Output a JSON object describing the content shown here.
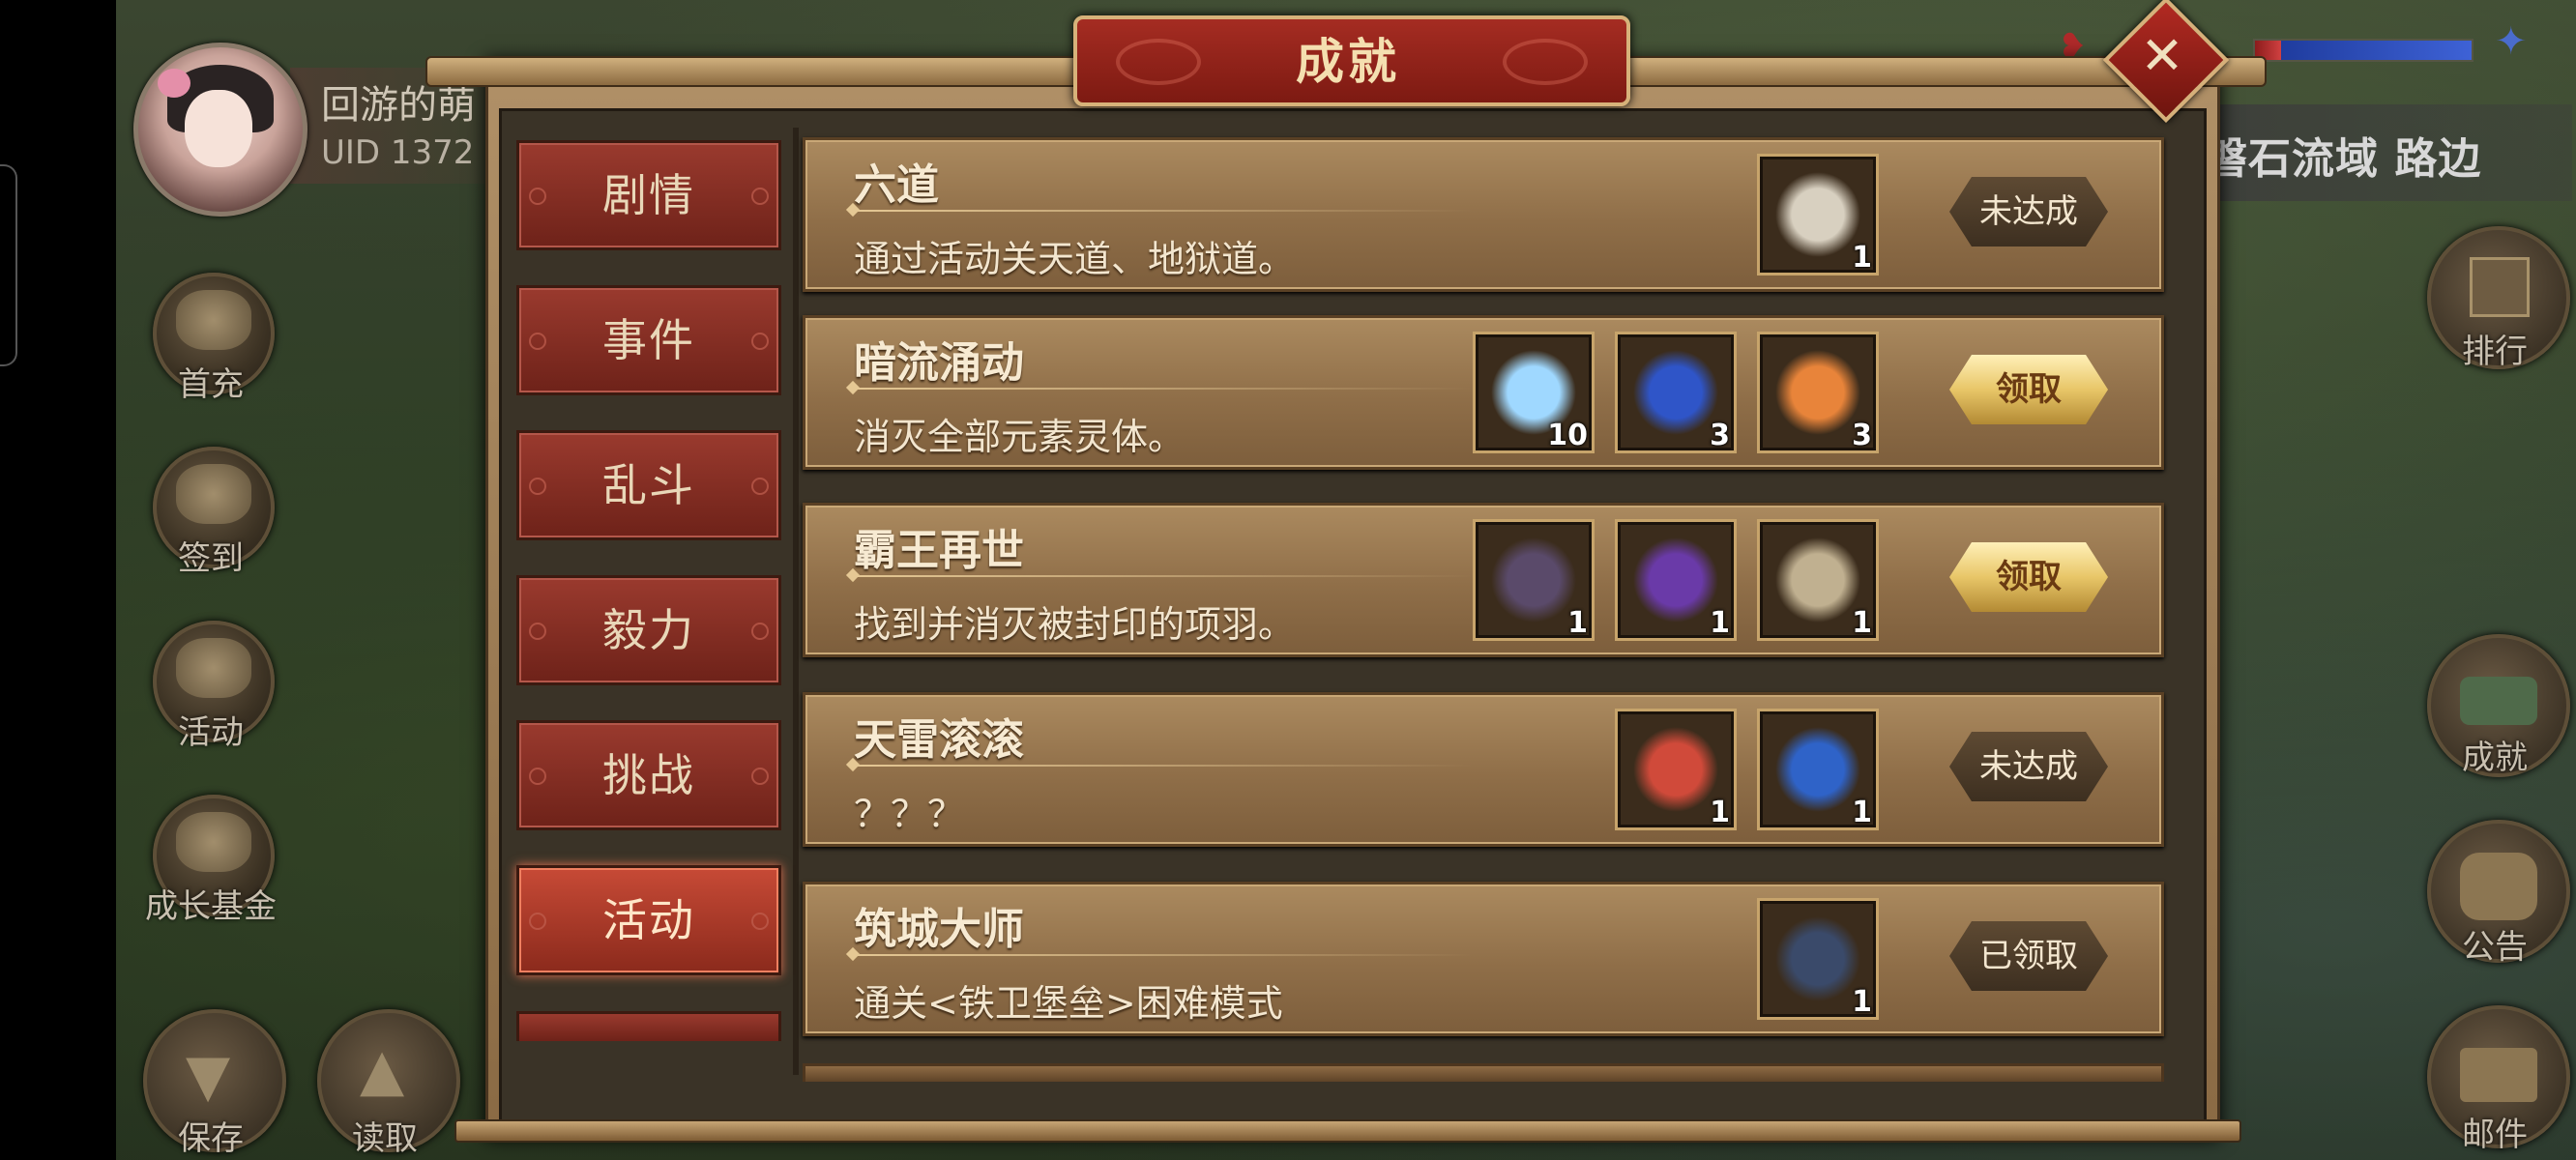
{
  "player": {
    "name": "回游的萌",
    "uid": "UID 1372"
  },
  "left_menu": [
    {
      "label": "首充",
      "icon": "gift-icon"
    },
    {
      "label": "签到",
      "icon": "scroll-brush-icon"
    },
    {
      "label": "活动",
      "icon": "treasure-icon"
    },
    {
      "label": "成长基金",
      "icon": "plant-icon"
    }
  ],
  "bottom_left": [
    {
      "label": "保存",
      "icon": "save-down-arrow-icon"
    },
    {
      "label": "读取",
      "icon": "load-up-arrow-icon"
    }
  ],
  "right_menu": [
    {
      "label": "排行",
      "icon": "ranking-board-icon"
    },
    {
      "label": "成就",
      "icon": "achievement-icon"
    },
    {
      "label": "公告",
      "icon": "scroll-notice-icon"
    },
    {
      "label": "邮件",
      "icon": "mail-icon"
    }
  ],
  "location": "磐石流域 路边",
  "hp": {
    "red_fraction": 0.12,
    "blue_fraction": 0.88
  },
  "panel": {
    "title": "成就",
    "close": "✕"
  },
  "tabs": [
    {
      "label": "剧情",
      "active": false
    },
    {
      "label": "事件",
      "active": false
    },
    {
      "label": "乱斗",
      "active": false
    },
    {
      "label": "毅力",
      "active": false
    },
    {
      "label": "挑战",
      "active": false
    },
    {
      "label": "活动",
      "active": true
    }
  ],
  "achievements": [
    {
      "title": "六道",
      "desc": "通过活动关天道、地狱道。",
      "rewards": [
        {
          "icon": "lightning-spear-icon",
          "qty": "1",
          "color": "#d8d0c0"
        }
      ],
      "status": "未达成",
      "state": "gray"
    },
    {
      "title": "暗流涌动",
      "desc": "消灭全部元素灵体。",
      "rewards": [
        {
          "icon": "ice-crystal-icon",
          "qty": "10",
          "color": "#9fd8ff"
        },
        {
          "icon": "blue-fruit-icon",
          "qty": "3",
          "color": "#2f55c8"
        },
        {
          "icon": "orange-fruit-icon",
          "qty": "3",
          "color": "#e8843a"
        }
      ],
      "status": "领取",
      "state": "gold"
    },
    {
      "title": "霸王再世",
      "desc": "找到并消灭被封印的项羽。",
      "rewards": [
        {
          "icon": "dark-horse-icon",
          "qty": "1",
          "color": "#5a4a6a"
        },
        {
          "icon": "purple-armor-icon",
          "qty": "1",
          "color": "#6a3aa8"
        },
        {
          "icon": "halberd-icon",
          "qty": "1",
          "color": "#c0b090"
        }
      ],
      "status": "领取",
      "state": "gold"
    },
    {
      "title": "天雷滚滚",
      "desc": "？？？",
      "rewards": [
        {
          "icon": "flame-orb-icon",
          "qty": "1",
          "color": "#d04a3a"
        },
        {
          "icon": "blue-scroll-icon",
          "qty": "1",
          "color": "#2f63c8"
        }
      ],
      "status": "未达成",
      "state": "gray"
    },
    {
      "title": "筑城大师",
      "desc": "通关<铁卫堡垒>困难模式",
      "rewards": [
        {
          "icon": "armored-horse-icon",
          "qty": "1",
          "color": "#3a4a6a"
        }
      ],
      "status": "已领取",
      "state": "gray"
    }
  ]
}
